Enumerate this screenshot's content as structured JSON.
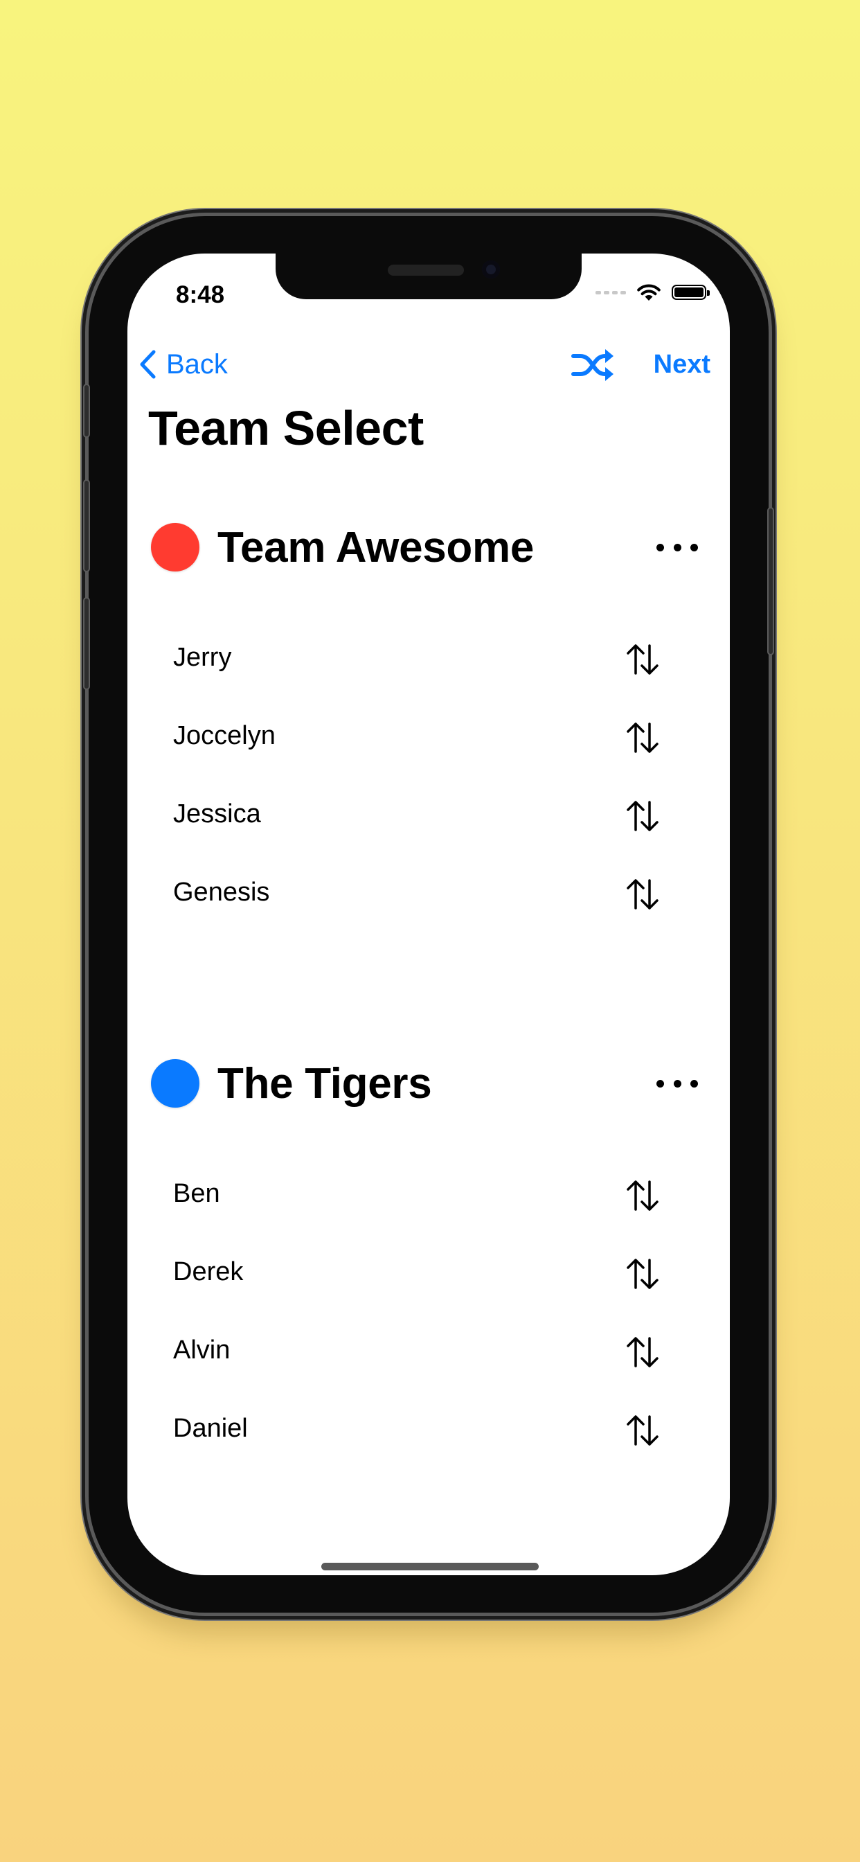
{
  "status_bar": {
    "time": "8:48"
  },
  "nav": {
    "back_label": "Back",
    "next_label": "Next"
  },
  "page_title": "Team Select",
  "teams": [
    {
      "name": "Team Awesome",
      "color": "#ff3b30",
      "members": [
        "Jerry",
        "Joccelyn",
        "Jessica",
        "Genesis"
      ]
    },
    {
      "name": "The Tigers",
      "color": "#0a7aff",
      "members": [
        "Ben",
        "Derek",
        "Alvin",
        "Daniel"
      ]
    }
  ],
  "colors": {
    "accent": "#0a7aff",
    "background_top": "#f8f47e",
    "background_bottom": "#f9d37e"
  },
  "icons": {
    "back": "chevron-left-icon",
    "shuffle": "shuffle-icon",
    "more": "ellipsis-icon",
    "swap": "arrow-up-down-icon"
  }
}
